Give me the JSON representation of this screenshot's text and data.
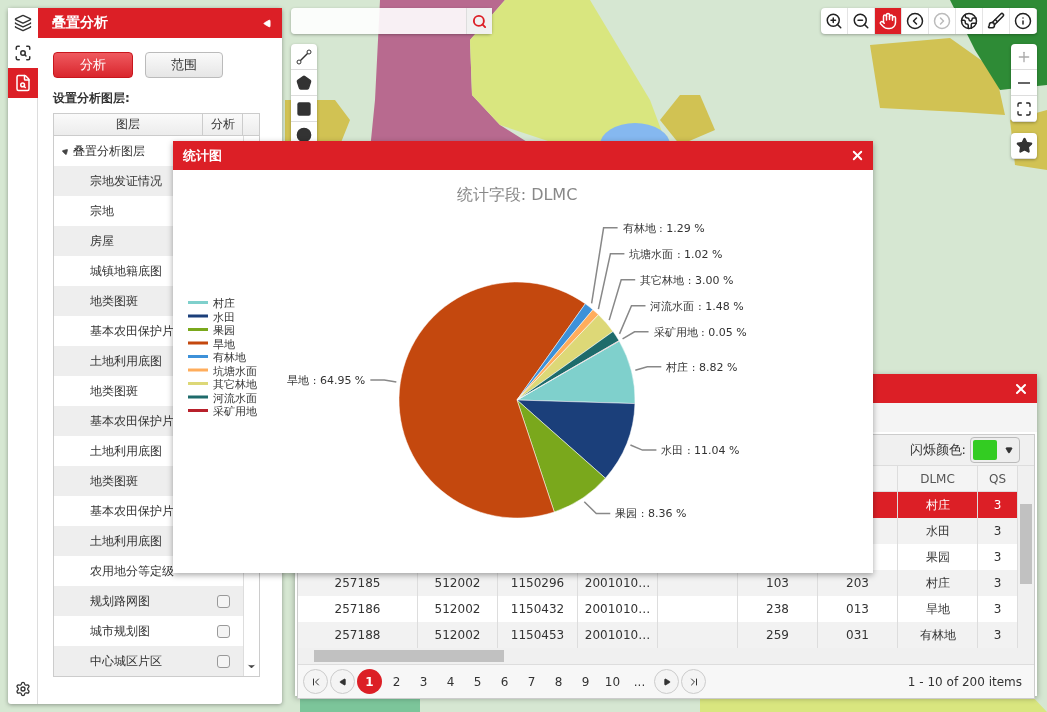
{
  "sidebar": {
    "icons": [
      {
        "kind": "layers",
        "selected": false
      },
      {
        "kind": "scan",
        "selected": false
      },
      {
        "kind": "overlay",
        "selected": true
      }
    ]
  },
  "panel": {
    "title": "叠置分析",
    "buttons": [
      {
        "label": "分析",
        "selected": true
      },
      {
        "label": "范围",
        "selected": false
      }
    ],
    "section_label": "设置分析图层:",
    "layer_table": {
      "columns": [
        "图层",
        "分析"
      ],
      "tree": [
        {
          "label": "叠置分析图层",
          "expanded": true,
          "children": [
            {
              "label": "宗地发证情况"
            },
            {
              "label": "宗地"
            },
            {
              "label": "房屋"
            },
            {
              "label": "城镇地籍底图"
            },
            {
              "label": "地类图斑"
            },
            {
              "label": "基本农田保护片"
            },
            {
              "label": "土地利用底图"
            },
            {
              "label": "地类图斑"
            },
            {
              "label": "基本农田保护片"
            },
            {
              "label": "土地利用底图"
            },
            {
              "label": "地类图斑"
            },
            {
              "label": "基本农田保护片"
            },
            {
              "label": "土地利用底图"
            },
            {
              "label": "农用地分等定级"
            },
            {
              "label": "规划路网图",
              "checked": false
            },
            {
              "label": "城市规划图",
              "checked": false
            },
            {
              "label": "中心城区片区",
              "checked": false
            }
          ]
        }
      ]
    }
  },
  "map_toolbar": [
    {
      "kind": "zoom-in",
      "selected": false,
      "disabled": false
    },
    {
      "kind": "zoom-out",
      "selected": false,
      "disabled": false
    },
    {
      "kind": "pan",
      "selected": true,
      "disabled": false
    },
    {
      "kind": "back",
      "selected": false,
      "disabled": false
    },
    {
      "kind": "forward",
      "selected": false,
      "disabled": true
    },
    {
      "kind": "globe",
      "selected": false,
      "disabled": false
    },
    {
      "kind": "brush",
      "selected": false,
      "disabled": false
    },
    {
      "kind": "info",
      "selected": false,
      "disabled": false
    }
  ],
  "chart_window": {
    "title": "统计图",
    "chart_data": {
      "type": "pie",
      "title": "统计字段: DLMC",
      "categories": [
        "村庄",
        "水田",
        "果园",
        "旱地",
        "有林地",
        "坑塘水面",
        "其它林地",
        "河流水面",
        "采矿用地"
      ],
      "values": [
        8.82,
        11.04,
        8.36,
        64.95,
        1.29,
        1.02,
        3.0,
        1.48,
        0.05
      ],
      "colors": [
        "#7fd0cc",
        "#1b3f7a",
        "#7aa81c",
        "#c4480e",
        "#3d91d9",
        "#ffad5c",
        "#ddd877",
        "#1e6b6b",
        "#b8202b"
      ],
      "data_labels": true,
      "legend": true,
      "value_labels": [
        "村庄 : 8.82 %",
        "水田 : 11.04 %",
        "果园 : 8.36 %",
        "旱地 : 64.95 %",
        "有林地 : 1.29 %",
        "坑塘水面 : 1.02 %",
        "其它林地 : 3.00 %",
        "河流水面 : 1.48 %",
        "采矿用地 : 0.05 %"
      ]
    }
  },
  "attribute_window": {
    "blink_color_label": "闪烁颜色:",
    "blink_swatch": {
      "color": "#33cc22"
    },
    "columns": [
      null,
      null,
      null,
      null,
      null,
      null,
      null,
      "DLMC",
      "QS"
    ],
    "rows": [
      {
        "selected": true,
        "cells": [
          null,
          null,
          null,
          null,
          null,
          null,
          null,
          "村庄",
          "3"
        ]
      },
      {
        "selected": false,
        "cells": [
          null,
          null,
          null,
          null,
          null,
          null,
          null,
          "水田",
          "3"
        ]
      },
      {
        "selected": false,
        "cells": [
          null,
          null,
          null,
          null,
          null,
          null,
          null,
          "果园",
          "3"
        ]
      },
      {
        "selected": false,
        "cells": [
          "257185",
          "512002",
          "1150296",
          "2001010…",
          null,
          "103",
          "203",
          "村庄",
          "3"
        ]
      },
      {
        "selected": false,
        "cells": [
          "257186",
          "512002",
          "1150432",
          "2001010…",
          null,
          "238",
          "013",
          "旱地",
          "3"
        ]
      },
      {
        "selected": false,
        "cells": [
          "257188",
          "512002",
          "1150453",
          "2001010…",
          null,
          "259",
          "031",
          "有林地",
          "3"
        ]
      }
    ],
    "pager": {
      "pages": [
        {
          "label": "1",
          "selected": true
        },
        {
          "label": "2",
          "selected": false
        },
        {
          "label": "3",
          "selected": false
        },
        {
          "label": "4",
          "selected": false
        },
        {
          "label": "5",
          "selected": false
        },
        {
          "label": "6",
          "selected": false
        },
        {
          "label": "7",
          "selected": false
        },
        {
          "label": "8",
          "selected": false
        },
        {
          "label": "9",
          "selected": false
        },
        {
          "label": "10",
          "selected": false
        },
        {
          "label": "...",
          "selected": false
        }
      ],
      "summary": "1 - 10 of 200 items"
    }
  }
}
